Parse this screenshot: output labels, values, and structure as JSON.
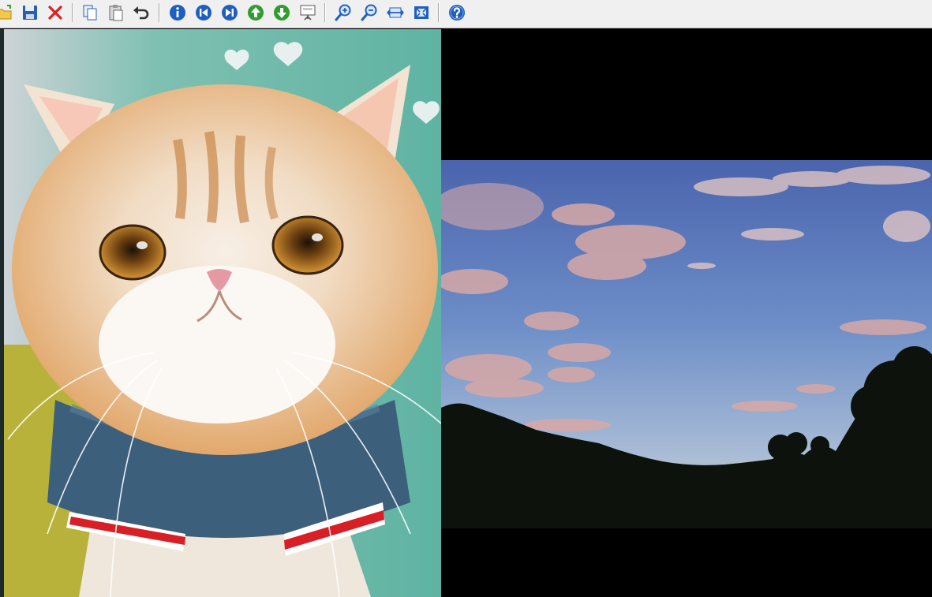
{
  "toolbar": {
    "buttons": [
      {
        "id": "open",
        "icon": "open-folder-icon"
      },
      {
        "id": "save",
        "icon": "floppy-disk-icon"
      },
      {
        "id": "delete",
        "icon": "red-x-icon"
      },
      {
        "id": "copy",
        "icon": "copy-icon"
      },
      {
        "id": "paste",
        "icon": "clipboard-icon"
      },
      {
        "id": "undo",
        "icon": "undo-arrow-icon"
      },
      {
        "id": "info",
        "icon": "info-icon"
      },
      {
        "id": "first",
        "icon": "skip-first-icon"
      },
      {
        "id": "last",
        "icon": "skip-last-icon"
      },
      {
        "id": "previous",
        "icon": "arrow-up-circle-icon"
      },
      {
        "id": "next",
        "icon": "arrow-down-circle-icon"
      },
      {
        "id": "slideshow",
        "icon": "presentation-screen-icon"
      },
      {
        "id": "zoom-in",
        "icon": "zoom-in-icon"
      },
      {
        "id": "zoom-out",
        "icon": "zoom-out-icon"
      },
      {
        "id": "fit-width",
        "icon": "fit-width-icon"
      },
      {
        "id": "fit-window",
        "icon": "fit-window-icon"
      },
      {
        "id": "help",
        "icon": "help-icon"
      }
    ],
    "colors": {
      "blue": "#1f5fbf",
      "green": "#2f9e2f",
      "red": "#e02020",
      "face": "#f0f0f0"
    }
  },
  "images": [
    {
      "subject": "cat",
      "colors": {
        "fur": "#e8b07a",
        "sweater": "#3c5f7c",
        "background": "#5fb3a2"
      }
    },
    {
      "subject": "sky",
      "colors": {
        "sky_top": "#4e6fb4",
        "sky_bottom": "#dcc8b0",
        "clouds": "#d9a6a0",
        "trees": "#0d120d"
      }
    }
  ]
}
